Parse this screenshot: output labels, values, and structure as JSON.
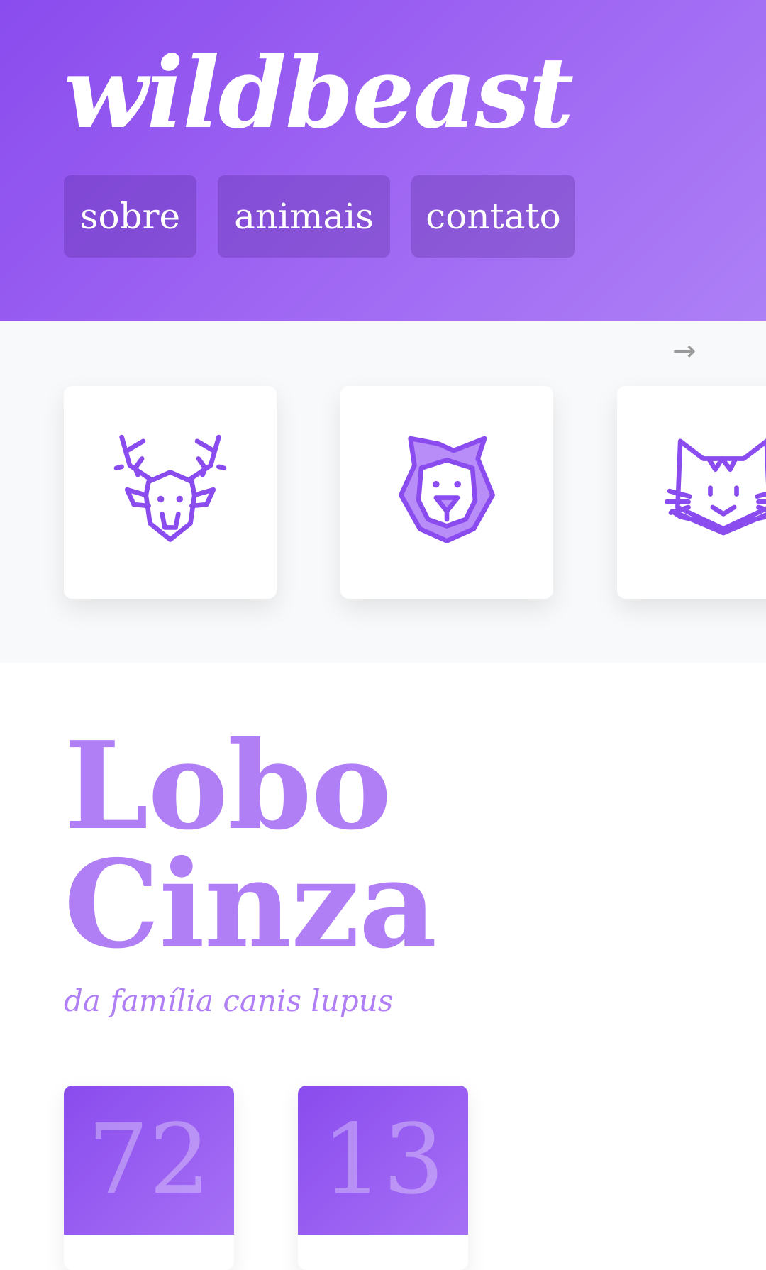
{
  "brand": {
    "name": "wildbeast"
  },
  "nav": {
    "items": [
      {
        "label": "sobre"
      },
      {
        "label": "animais"
      },
      {
        "label": "contato"
      }
    ]
  },
  "carousel": {
    "next_arrow": "→",
    "cards": [
      {
        "icon": "deer-icon"
      },
      {
        "icon": "lion-icon"
      },
      {
        "icon": "cat-icon"
      }
    ]
  },
  "animal": {
    "name_line1": "Lobo",
    "name_line2": "Cinza",
    "family": "da família canis lupus"
  },
  "stats": [
    {
      "value": "72"
    },
    {
      "value": "13"
    }
  ],
  "colors": {
    "accent": "#8a4cee",
    "accent_light": "#b07ff5",
    "carousel_bg": "#f8f9fa"
  }
}
